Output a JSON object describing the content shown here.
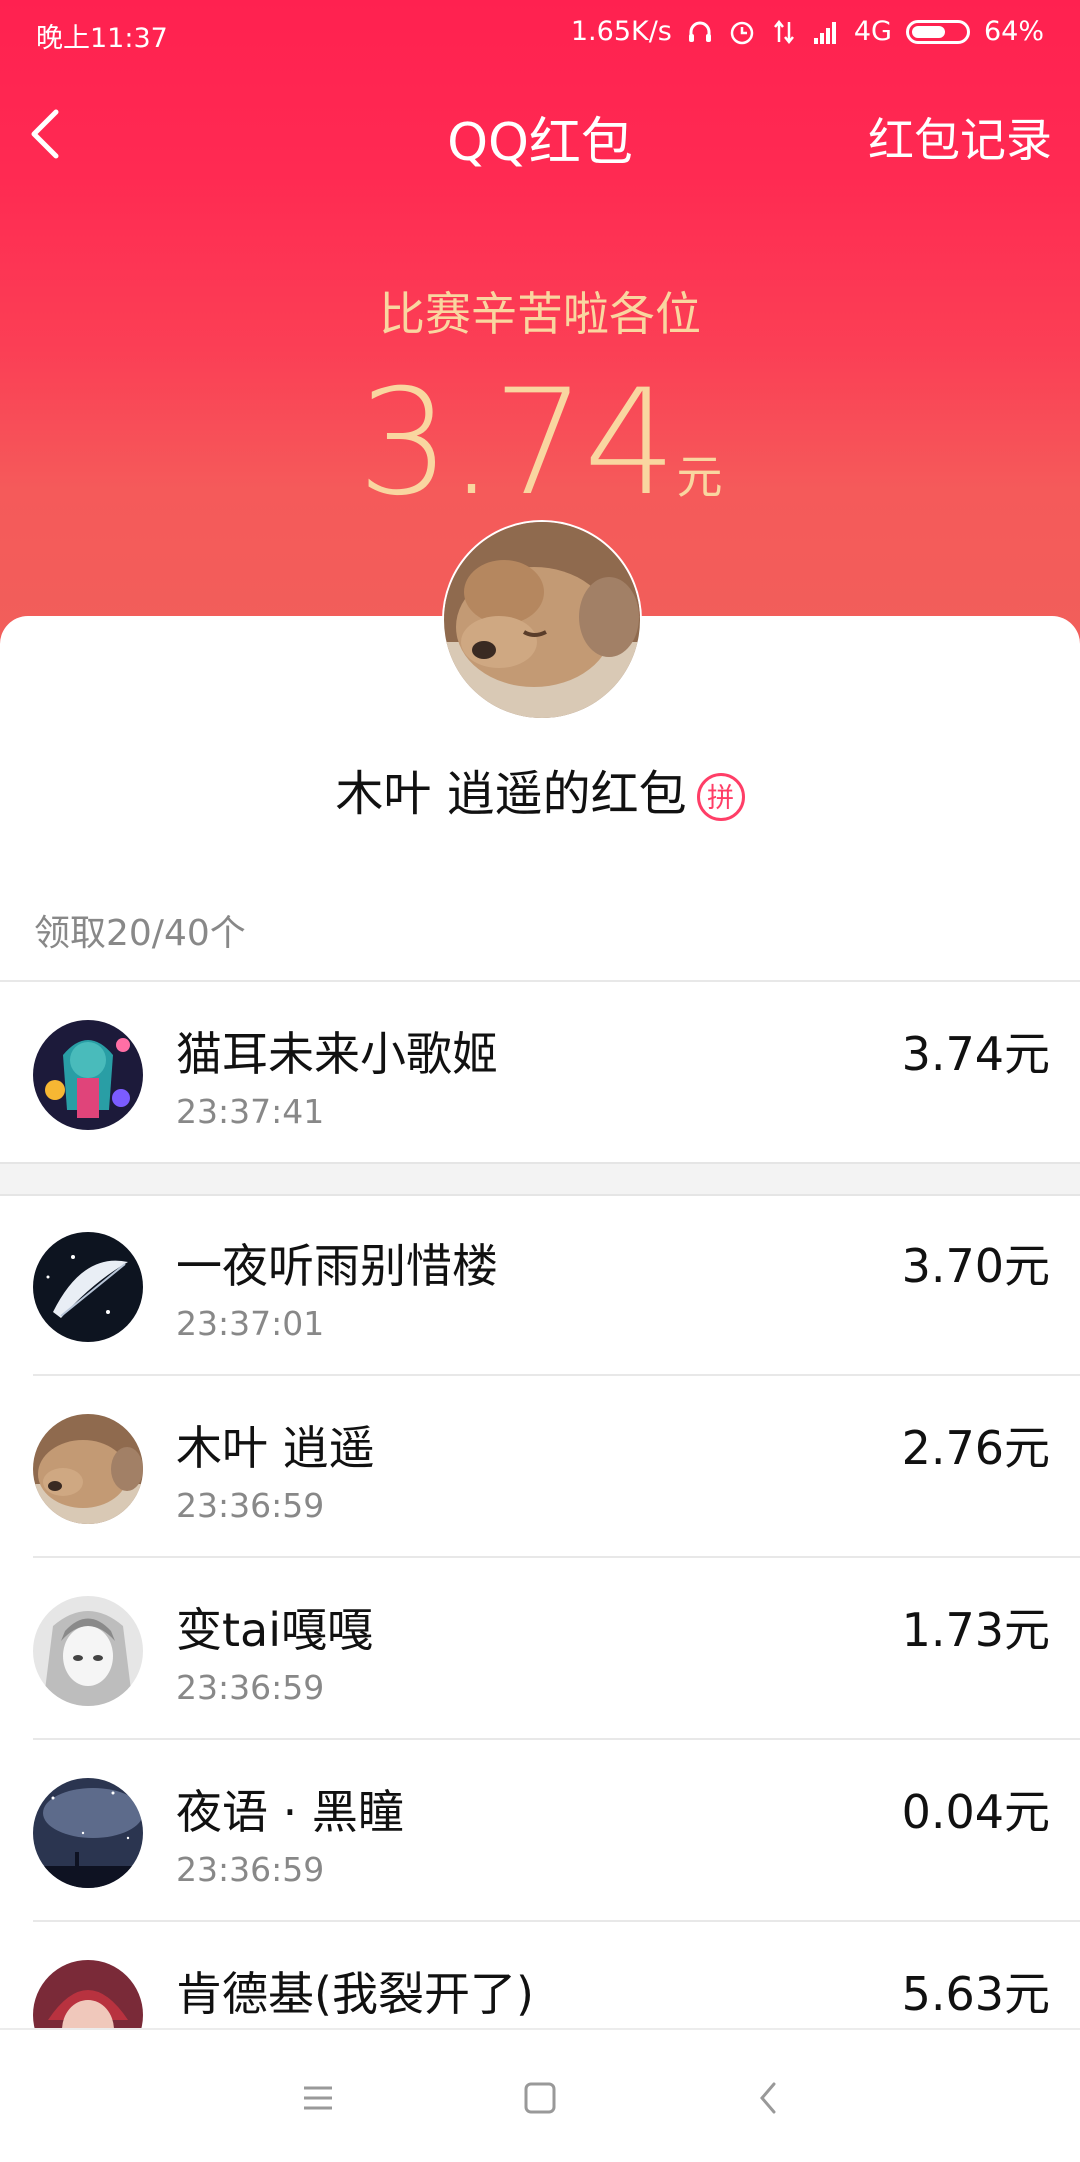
{
  "status_bar": {
    "time": "晚上11:37",
    "network_speed": "1.65K/s",
    "network_type": "4G",
    "battery": "64%",
    "battery_level": 0.64
  },
  "nav": {
    "title": "QQ红包",
    "record_link": "红包记录"
  },
  "envelope": {
    "blessing": "比赛辛苦啦各位",
    "amount": "3.74",
    "unit": "元",
    "sender_text": "木叶 逍遥的红包",
    "type_badge": "拼"
  },
  "summary": {
    "count_label": "领取20/40个"
  },
  "claims": [
    {
      "name": "猫耳未来小歌姬",
      "time": "23:37:41",
      "amount": "3.74元",
      "avatar": "anime-girl-colorful"
    },
    {
      "name": "一夜听雨别惜楼",
      "time": "23:37:01",
      "amount": "3.70元",
      "avatar": "feather-night"
    },
    {
      "name": "木叶 逍遥",
      "time": "23:36:59",
      "amount": "2.76元",
      "avatar": "puppy"
    },
    {
      "name": "变tai嘎嘎",
      "time": "23:36:59",
      "amount": "1.73元",
      "avatar": "anime-grayscale"
    },
    {
      "name": "夜语 · 黑瞳",
      "time": "23:36:59",
      "amount": "0.04元",
      "avatar": "starry-sky"
    },
    {
      "name": "肯德基(我裂开了)",
      "time": "",
      "amount": "5.63元",
      "avatar": "anime-boy-red"
    }
  ],
  "colors": {
    "header_top": "#ff2150",
    "header_bottom": "#f0605b",
    "gold_text": "#f9d6a0",
    "badge": "#ff3e67"
  },
  "bottom_nav": {
    "icons": [
      "menu-icon",
      "home-icon",
      "back-icon"
    ]
  }
}
